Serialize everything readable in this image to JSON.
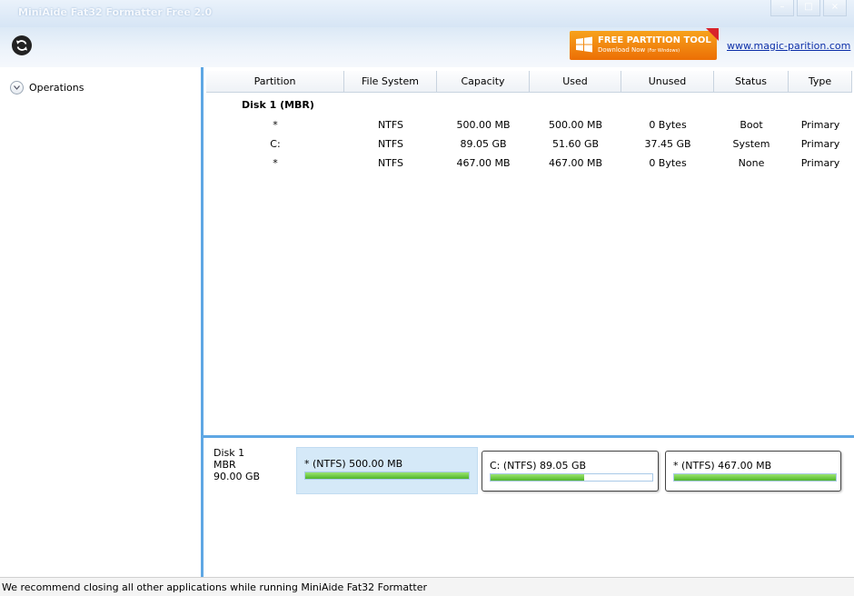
{
  "window": {
    "title": "MiniAide Fat32 Formatter Free 2.0",
    "controls": [
      "–",
      "□",
      "×"
    ]
  },
  "toolbar": {
    "refresh_icon": "refresh-icon",
    "promo_line1": "FREE PARTITION TOOL",
    "promo_line2": "Download Now",
    "promo_sub": "(For Windows)",
    "link": "www.magic-parition.com"
  },
  "sidebar": {
    "operations_label": "Operations"
  },
  "table": {
    "columns": [
      "Partition",
      "File System",
      "Capacity",
      "Used",
      "Unused",
      "Status",
      "Type"
    ],
    "disk_label": "Disk 1 (MBR)",
    "rows": [
      [
        "*",
        "NTFS",
        "500.00 MB",
        "500.00 MB",
        "0 Bytes",
        "Boot",
        "Primary"
      ],
      [
        "C:",
        "NTFS",
        "89.05 GB",
        "51.60 GB",
        "37.45 GB",
        "System",
        "Primary"
      ],
      [
        "*",
        "NTFS",
        "467.00 MB",
        "467.00 MB",
        "0 Bytes",
        "None",
        "Primary"
      ]
    ]
  },
  "disk_map": {
    "disk_name": "Disk 1",
    "disk_type": "MBR",
    "disk_size": "90.00 GB",
    "partitions": [
      {
        "label": "* (NTFS) 500.00 MB",
        "used_fraction": 1.0,
        "selected": true
      },
      {
        "label": "C: (NTFS) 89.05 GB",
        "used_fraction": 0.579,
        "selected": false
      },
      {
        "label": "* (NTFS) 467.00 MB",
        "used_fraction": 1.0,
        "selected": false
      }
    ]
  },
  "status": "We recommend closing all other applications while running MiniAide Fat32 Formatter"
}
